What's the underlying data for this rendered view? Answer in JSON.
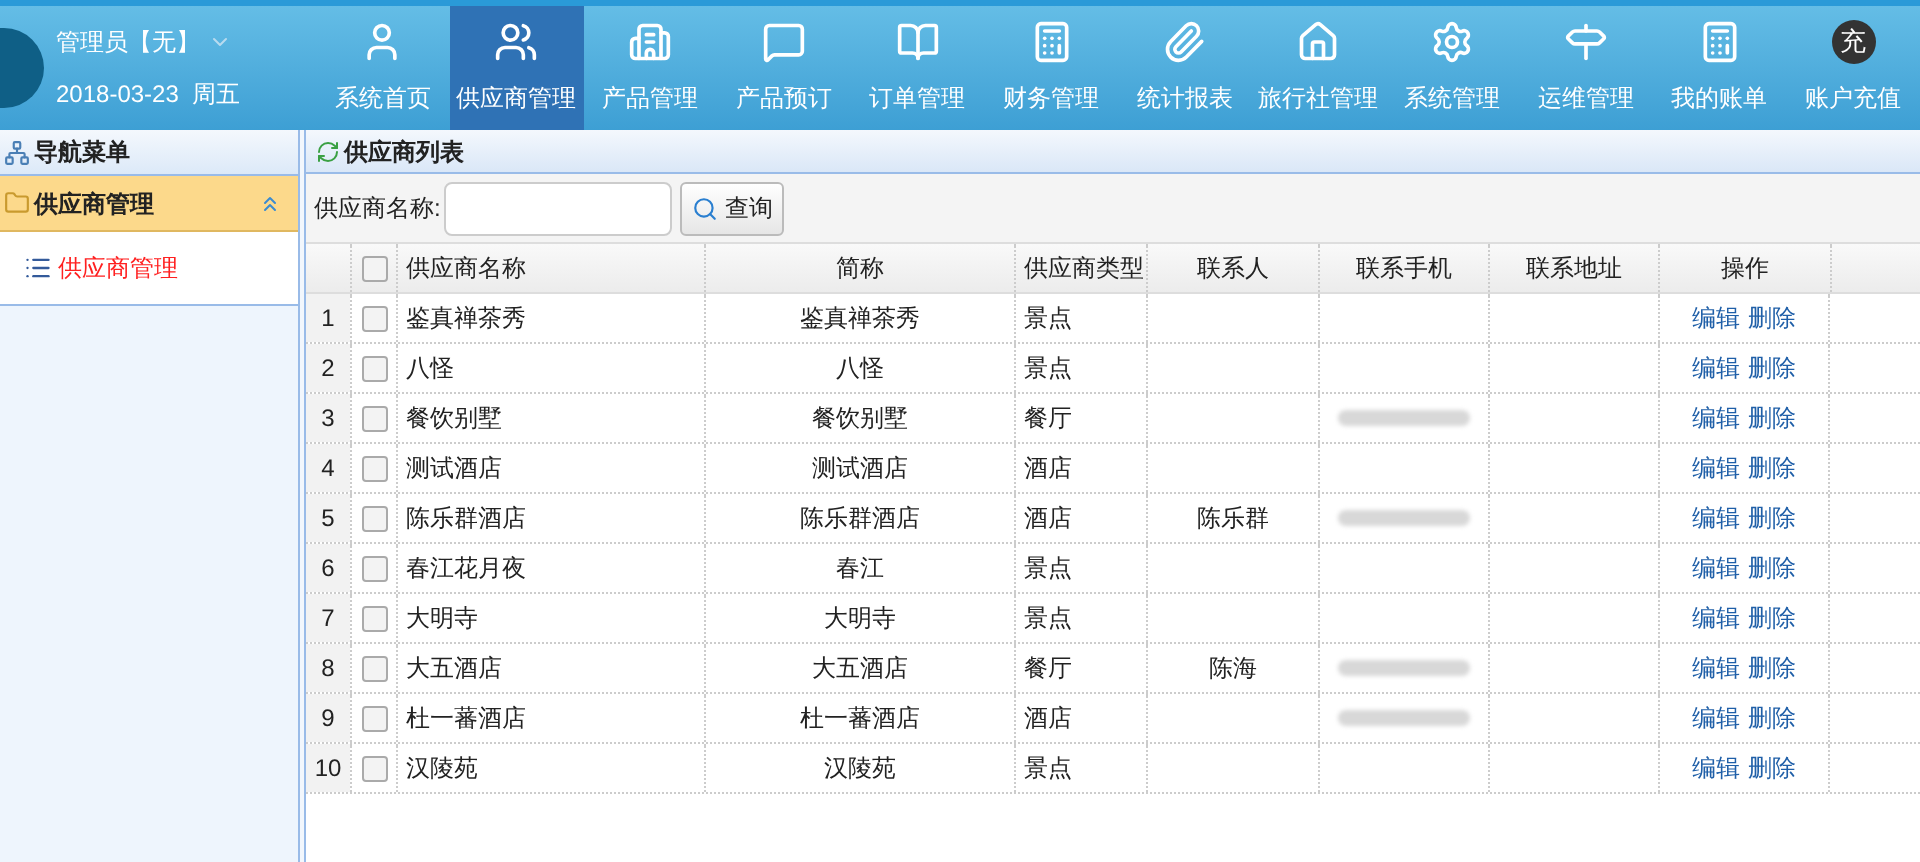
{
  "user": {
    "name": "管理员【无】",
    "date": "2018-03-23  周五"
  },
  "nav": [
    {
      "label": "系统首页",
      "selected": false
    },
    {
      "label": "供应商管理",
      "selected": true
    },
    {
      "label": "产品管理",
      "selected": false
    },
    {
      "label": "产品预订",
      "selected": false
    },
    {
      "label": "订单管理",
      "selected": false
    },
    {
      "label": "财务管理",
      "selected": false
    },
    {
      "label": "统计报表",
      "selected": false
    },
    {
      "label": "旅行社管理",
      "selected": false
    },
    {
      "label": "系统管理",
      "selected": false
    },
    {
      "label": "运维管理",
      "selected": false
    },
    {
      "label": "我的账单",
      "selected": false
    },
    {
      "label": "账户充值",
      "badge_text": "充",
      "selected": false
    }
  ],
  "sidebar": {
    "title": "导航菜单",
    "group": {
      "label": "供应商管理",
      "expanded": true,
      "items": [
        {
          "label": "供应商管理",
          "selected": true
        }
      ]
    }
  },
  "panel": {
    "title": "供应商列表",
    "search_label": "供应商名称:",
    "search_button": "查询"
  },
  "table": {
    "all_checked": false,
    "columns": [
      "供应商名称",
      "简称",
      "供应商类型",
      "联系人",
      "联系手机",
      "联系地址",
      "操作"
    ],
    "rows": [
      {
        "index": "1",
        "checked": false,
        "name": "鉴真禅茶秀",
        "short": "鉴真禅茶秀",
        "type": "景点",
        "phone_blurred": false,
        "edit": "编辑",
        "delete": "删除"
      },
      {
        "index": "2",
        "checked": false,
        "name": "八怪",
        "short": "八怪",
        "type": "景点",
        "phone_blurred": false,
        "edit": "编辑",
        "delete": "删除"
      },
      {
        "index": "3",
        "checked": false,
        "name": "餐饮别墅",
        "short": "餐饮别墅",
        "type": "餐厅",
        "phone_blurred": true,
        "edit": "编辑",
        "delete": "删除"
      },
      {
        "index": "4",
        "checked": false,
        "name": "测试酒店",
        "short": "测试酒店",
        "type": "酒店",
        "phone_blurred": false,
        "edit": "编辑",
        "delete": "删除"
      },
      {
        "index": "5",
        "checked": false,
        "name": "陈乐群酒店",
        "short": "陈乐群酒店",
        "type": "酒店",
        "contact": "陈乐群",
        "phone_blurred": true,
        "edit": "编辑",
        "delete": "删除"
      },
      {
        "index": "6",
        "checked": false,
        "name": "春江花月夜",
        "short": "春江",
        "type": "景点",
        "phone_blurred": false,
        "edit": "编辑",
        "delete": "删除"
      },
      {
        "index": "7",
        "checked": false,
        "name": "大明寺",
        "short": "大明寺",
        "type": "景点",
        "phone_blurred": false,
        "edit": "编辑",
        "delete": "删除"
      },
      {
        "index": "8",
        "checked": false,
        "name": "大五酒店",
        "short": "大五酒店",
        "type": "餐厅",
        "contact": "陈海",
        "phone_blurred": true,
        "edit": "编辑",
        "delete": "删除"
      },
      {
        "index": "9",
        "checked": false,
        "name": "杜一蕃酒店",
        "short": "杜一蕃酒店",
        "type": "酒店",
        "phone_blurred": true,
        "edit": "编辑",
        "delete": "删除"
      },
      {
        "index": "10",
        "checked": false,
        "name": "汉陵苑",
        "short": "汉陵苑",
        "type": "景点",
        "phone_blurred": false,
        "edit": "编辑",
        "delete": "删除"
      }
    ]
  }
}
